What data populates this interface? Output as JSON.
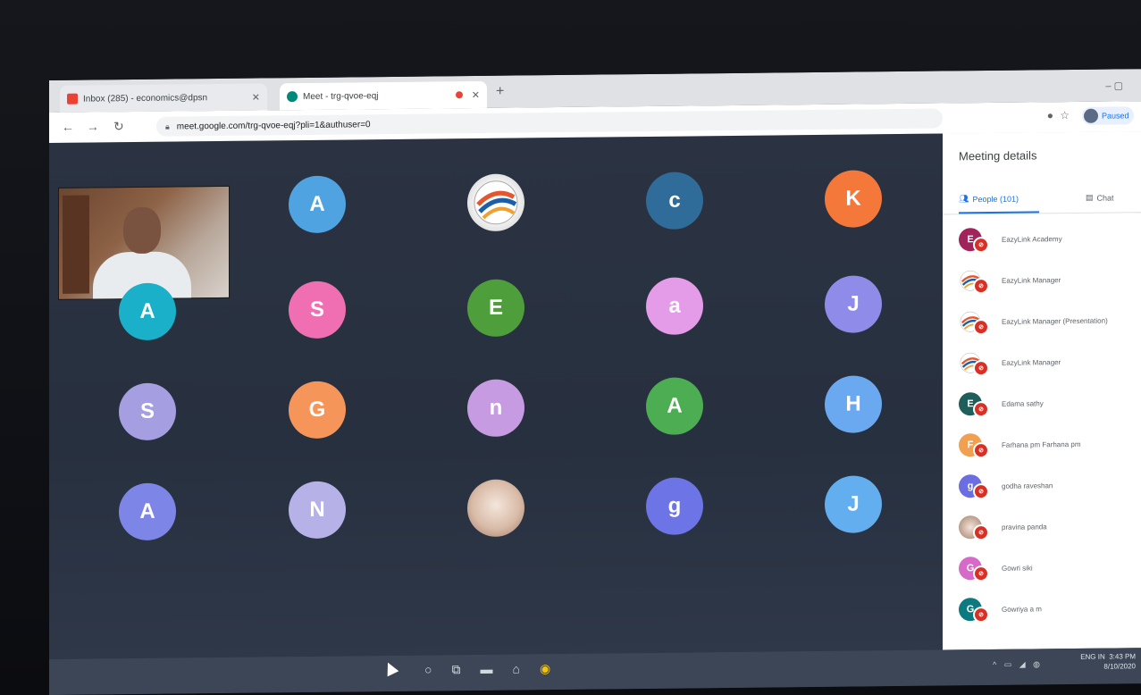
{
  "browser": {
    "tabs": [
      {
        "title": "Inbox (285) - economics@dpsn",
        "favicon": "gmail-icon",
        "color": "#ea4335"
      },
      {
        "title": "Meet - trg-qvoe-eqj",
        "favicon": "meet-icon",
        "color": "#00897b"
      }
    ],
    "new_tab": "+",
    "window_controls": "–  ▢",
    "url": "meet.google.com/trg-qvoe-eqj?pli=1&authuser=0",
    "profile_label": "Paused"
  },
  "stage": {
    "self_view": "participant-video",
    "tiles": [
      {
        "letter": "A",
        "color": "#4fa3e0"
      },
      {
        "letter": "",
        "kind": "logo"
      },
      {
        "letter": "c",
        "color": "#2f6c9a"
      },
      {
        "letter": "K",
        "color": "#f4783a"
      },
      {
        "letter": "A",
        "color": "#1ab0c9"
      },
      {
        "letter": "S",
        "color": "#ef6fb2"
      },
      {
        "letter": "E",
        "color": "#4f9e3c"
      },
      {
        "letter": "a",
        "color": "#e49be8"
      },
      {
        "letter": "J",
        "color": "#8e8ce8"
      },
      {
        "letter": "S",
        "color": "#a59ee0"
      },
      {
        "letter": "G",
        "color": "#f5955a"
      },
      {
        "letter": "n",
        "color": "#c79be2"
      },
      {
        "letter": "A",
        "color": "#4cad52"
      },
      {
        "letter": "H",
        "color": "#6aa9f0"
      },
      {
        "letter": "A",
        "color": "#7d86e6"
      },
      {
        "letter": "N",
        "color": "#b6b2e8"
      },
      {
        "letter": "",
        "kind": "photo"
      },
      {
        "letter": "g",
        "color": "#6c74e6"
      },
      {
        "letter": "J",
        "color": "#62aeee"
      }
    ]
  },
  "panel": {
    "title": "Meeting details",
    "people_tab": "People (101)",
    "chat_tab": "Chat",
    "people": [
      {
        "initial": "E",
        "color": "#a0245a",
        "name": "EazyLink Academy"
      },
      {
        "initial": "",
        "color": "logo",
        "name": "EazyLink Manager"
      },
      {
        "initial": "",
        "color": "logo",
        "name": "EazyLink Manager (Presentation)"
      },
      {
        "initial": "",
        "color": "logo",
        "name": "EazyLink Manager"
      },
      {
        "initial": "E",
        "color": "#1f5e5a",
        "name": "Edama sathy"
      },
      {
        "initial": "F",
        "color": "#f0a050",
        "name": "Farhana pm Farhana pm"
      },
      {
        "initial": "g",
        "color": "#6b6ee0",
        "name": "godha raveshan"
      },
      {
        "initial": "",
        "color": "photo",
        "name": "pravina panda"
      },
      {
        "initial": "G",
        "color": "#d56ac7",
        "name": "Gowri siki"
      },
      {
        "initial": "G",
        "color": "#0c7a7f",
        "name": "Gowriya a m"
      }
    ]
  },
  "taskbar": {
    "icons": [
      "search-icon",
      "task-view-icon",
      "file-explorer-icon",
      "store-icon",
      "chrome-icon"
    ],
    "lang": "ENG IN",
    "time": "3:43 PM",
    "date": "8/10/2020"
  }
}
